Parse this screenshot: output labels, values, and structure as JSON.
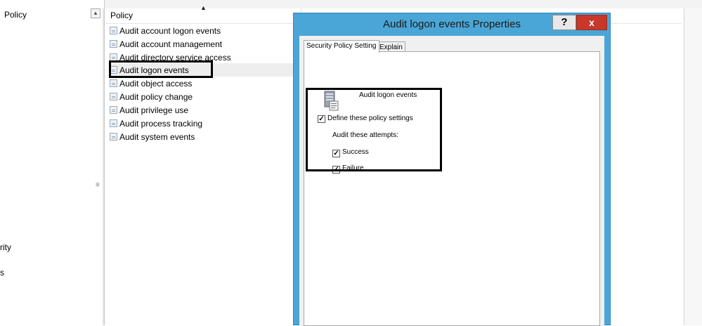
{
  "left_pane": {
    "items": [
      "Policy",
      "rity",
      "s"
    ]
  },
  "list": {
    "column_header": "Policy",
    "rows": [
      "Audit account logon events",
      "Audit account management",
      "Audit directory service access",
      "Audit logon events",
      "Audit object access",
      "Audit policy change",
      "Audit privilege use",
      "Audit process tracking",
      "Audit system events"
    ]
  },
  "dialog": {
    "title": "Audit logon events Properties",
    "help_label": "?",
    "close_label": "x",
    "tabs": [
      "Security Policy Setting",
      "Explain"
    ],
    "policy_name": "Audit logon events",
    "define_label": "Define these policy settings",
    "audit_attempts_label": "Audit these attempts:",
    "success_label": "Success",
    "failure_label": "Failure",
    "check_mark": "✓"
  },
  "colors": {
    "dialog_frame": "#4aa6d6",
    "close_button": "#c7382b"
  }
}
